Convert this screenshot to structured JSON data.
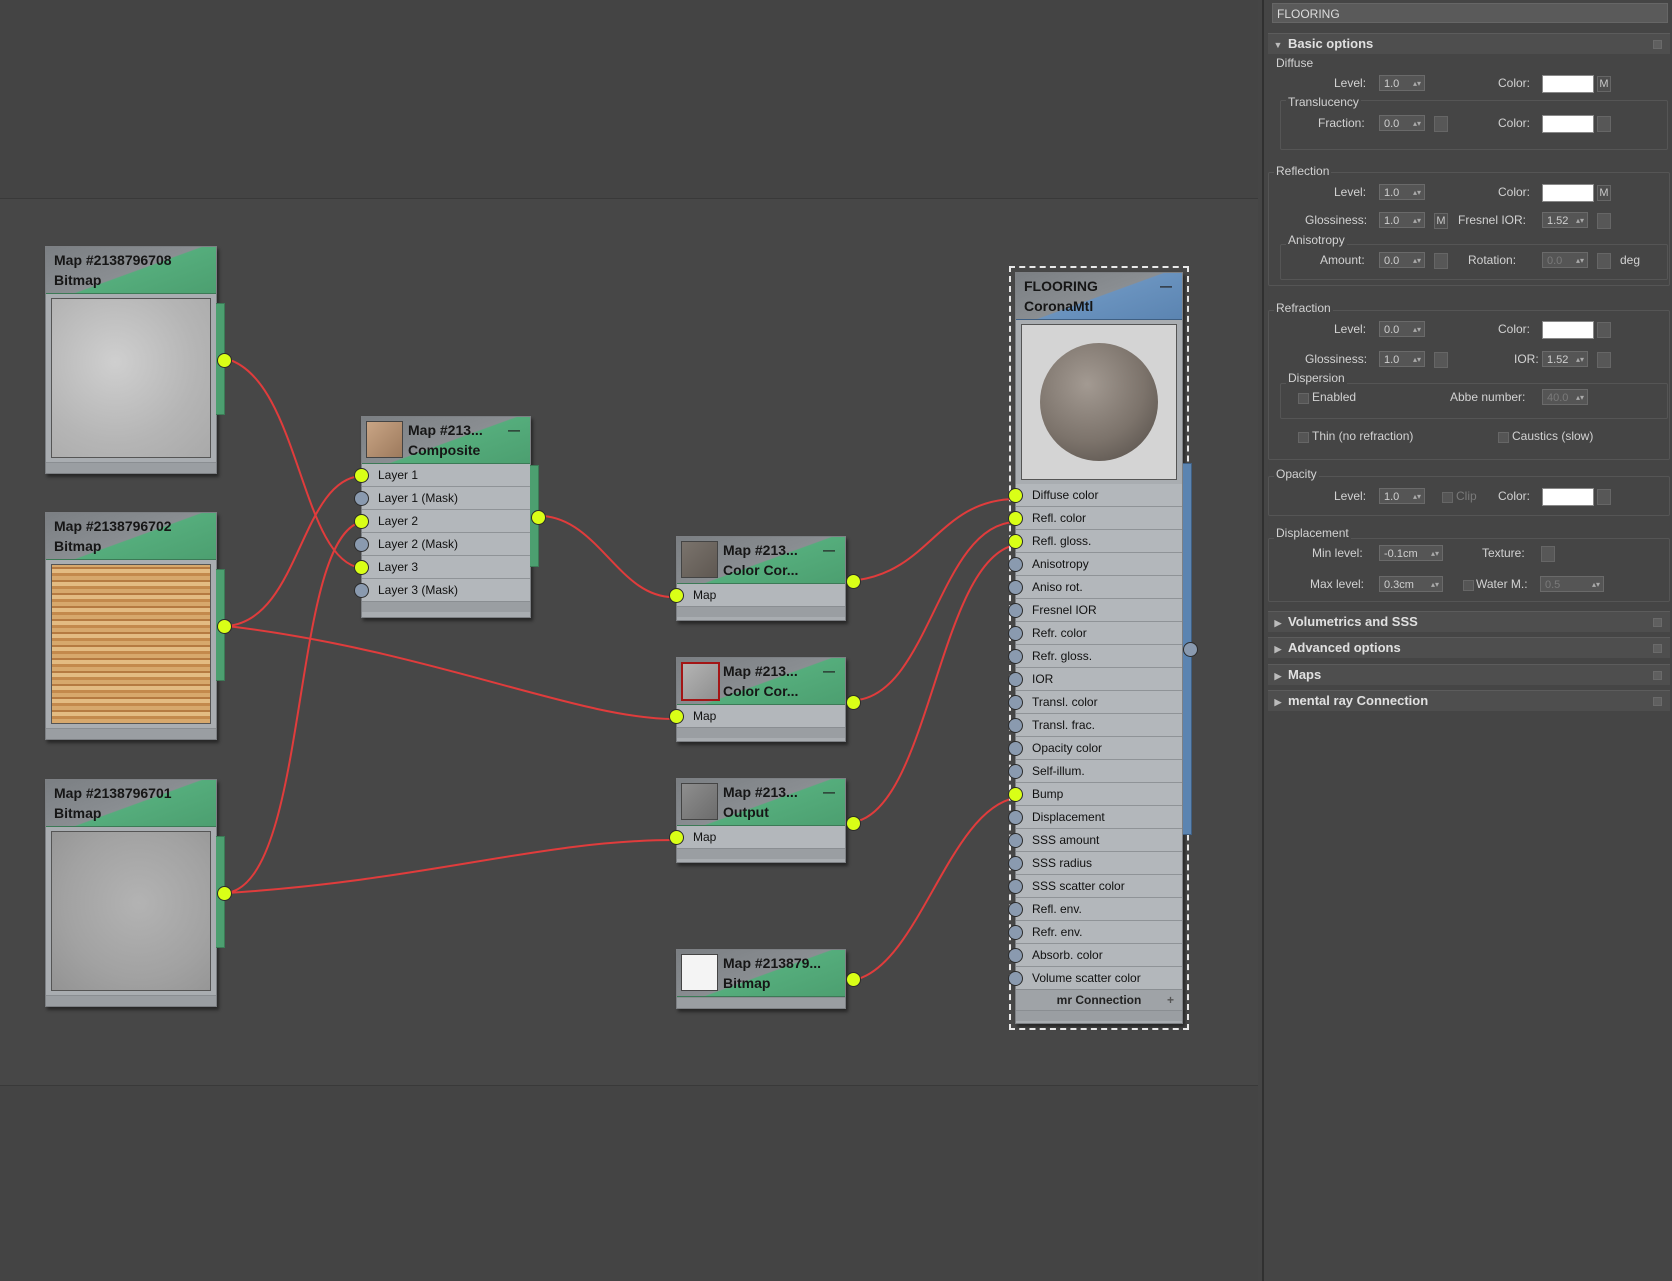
{
  "nodes": {
    "bmp708": {
      "title": "Map #2138796708",
      "subtitle": "Bitmap"
    },
    "bmp702": {
      "title": "Map #2138796702",
      "subtitle": "Bitmap"
    },
    "bmp701": {
      "title": "Map #2138796701",
      "subtitle": "Bitmap"
    },
    "composite": {
      "title": "Map #213...",
      "subtitle": "Composite",
      "rows": [
        "Layer 1",
        "Layer 1 (Mask)",
        "Layer 2",
        "Layer 2 (Mask)",
        "Layer 3",
        "Layer 3 (Mask)"
      ]
    },
    "cc1": {
      "title": "Map #213...",
      "subtitle": "Color Cor...",
      "row": "Map"
    },
    "cc2": {
      "title": "Map #213...",
      "subtitle": "Color Cor...",
      "row": "Map"
    },
    "output": {
      "title": "Map #213...",
      "subtitle": "Output",
      "row": "Map"
    },
    "bmp879": {
      "title": "Map #213879...",
      "subtitle": "Bitmap"
    },
    "material": {
      "title": "FLOORING",
      "subtitle": "CoronaMtl",
      "slots": [
        "Diffuse color",
        "Refl. color",
        "Refl. gloss.",
        "Anisotropy",
        "Aniso rot.",
        "Fresnel IOR",
        "Refr. color",
        "Refr. gloss.",
        "IOR",
        "Transl. color",
        "Transl. frac.",
        "Opacity color",
        "Self-illum.",
        "Bump",
        "Displacement",
        "SSS amount",
        "SSS radius",
        "SSS scatter color",
        "Refl. env.",
        "Refr. env.",
        "Absorb. color",
        "Volume scatter color"
      ],
      "footer": "mr Connection",
      "footer_plus": "+"
    }
  },
  "panel": {
    "title": "FLOORING",
    "basic_options": "Basic options",
    "diffuse": {
      "label": "Diffuse",
      "level_label": "Level:",
      "level": "1.0",
      "color_label": "Color:",
      "map_btn": "M"
    },
    "translucency": {
      "label": "Translucency",
      "fraction_label": "Fraction:",
      "fraction": "0.0",
      "color_label": "Color:"
    },
    "reflection": {
      "label": "Reflection",
      "level_label": "Level:",
      "level": "1.0",
      "color_label": "Color:",
      "map_btn": "M",
      "gloss_label": "Glossiness:",
      "gloss": "1.0",
      "gloss_map": "M",
      "fresnel_label": "Fresnel IOR:",
      "fresnel": "1.52"
    },
    "anisotropy": {
      "label": "Anisotropy",
      "amount_label": "Amount:",
      "amount": "0.0",
      "rotation_label": "Rotation:",
      "rotation": "0.0",
      "unit": "deg"
    },
    "refraction": {
      "label": "Refraction",
      "level_label": "Level:",
      "level": "0.0",
      "color_label": "Color:",
      "gloss_label": "Glossiness:",
      "gloss": "1.0",
      "ior_label": "IOR:",
      "ior": "1.52"
    },
    "dispersion": {
      "label": "Dispersion",
      "enabled_label": "Enabled",
      "abbe_label": "Abbe number:",
      "abbe": "40.0"
    },
    "thin_label": "Thin (no refraction)",
    "caustics_label": "Caustics (slow)",
    "opacity": {
      "label": "Opacity",
      "level_label": "Level:",
      "level": "1.0",
      "clip_label": "Clip",
      "color_label": "Color:"
    },
    "displacement": {
      "label": "Displacement",
      "min_label": "Min level:",
      "min": "-0.1cm",
      "texture_label": "Texture:",
      "max_label": "Max level:",
      "max": "0.3cm",
      "water_label": "Water M.:",
      "water": "0.5"
    },
    "rollouts": [
      "Volumetrics and SSS",
      "Advanced options",
      "Maps",
      "mental ray Connection"
    ]
  },
  "colors": {
    "wire": "#e03c3c",
    "port_on": "#d9ff17",
    "node_head": "#4c9f70",
    "material_head": "#5b84b1"
  }
}
